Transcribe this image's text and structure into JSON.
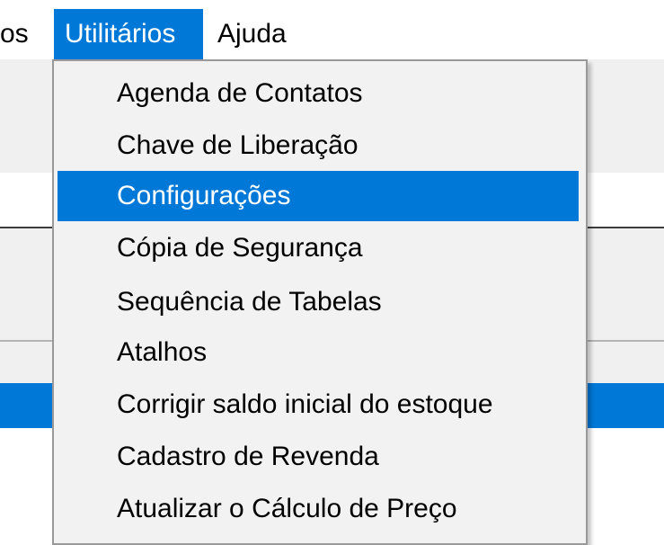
{
  "colors": {
    "menu_highlight": "#0078d7",
    "menu_background": "#f2f2f2",
    "app_background": "#f0f0f0"
  },
  "menubar": {
    "partial_label": "os",
    "active_label": "Utilitários",
    "help_label": "Ajuda"
  },
  "dropdown": {
    "highlighted_index": 2,
    "items": [
      {
        "label": "Agenda de Contatos"
      },
      {
        "label": "Chave de Liberação"
      },
      {
        "label": "Configurações"
      },
      {
        "label": "Cópia de Segurança"
      },
      {
        "label": "Sequência de Tabelas"
      },
      {
        "label": "Atalhos"
      },
      {
        "label": "Corrigir saldo inicial do estoque"
      },
      {
        "label": "Cadastro de Revenda"
      },
      {
        "label": "Atualizar o Cálculo de Preço"
      }
    ]
  }
}
